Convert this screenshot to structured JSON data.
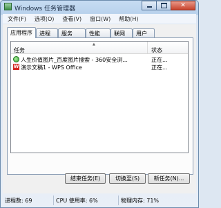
{
  "window": {
    "title": "Windows 任务管理器"
  },
  "menu": [
    "文件(F)",
    "选项(O)",
    "查看(V)",
    "窗口(W)",
    "帮助(H)"
  ],
  "tabs": [
    "应用程序",
    "进程",
    "服务",
    "性能",
    "联网",
    "用户"
  ],
  "list": {
    "header_task": "任务",
    "header_status": "状态",
    "rows": [
      {
        "name": "人生价值图片_百度图片搜索 - 360安全浏...",
        "status": "正在...",
        "icon": "browser-icon"
      },
      {
        "name": "演示文稿1 - WPS Office",
        "status": "正在...",
        "icon": "wps-icon"
      }
    ]
  },
  "buttons": {
    "end_task": "结束任务(E)",
    "switch_to": "切换至(S)",
    "new_task": "新任务(N)..."
  },
  "status": {
    "processes": "进程数: 69",
    "cpu": "CPU 使用率: 6%",
    "memory": "物理内存: 71%"
  }
}
